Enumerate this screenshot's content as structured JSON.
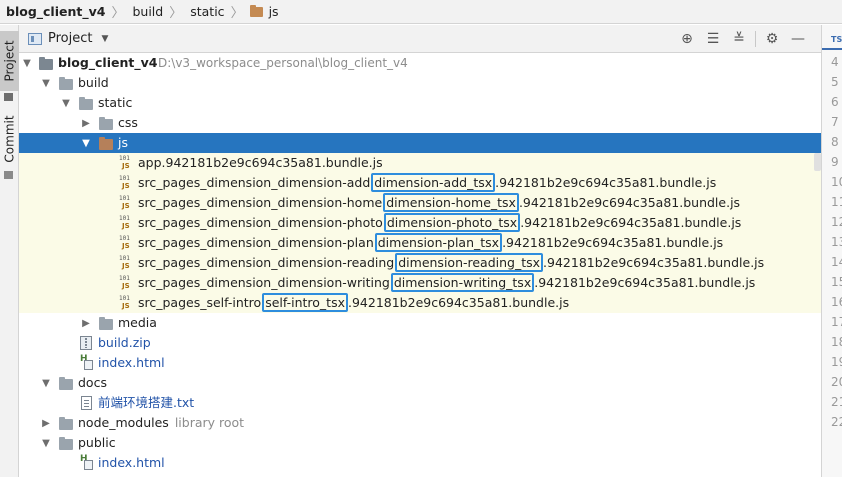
{
  "breadcrumb": {
    "items": [
      "blog_client_v4",
      "build",
      "static",
      "js"
    ]
  },
  "left_strip": {
    "project_tab": "Project",
    "commit_tab": "Commit"
  },
  "panel": {
    "title": "Project",
    "actions": [
      "locate-icon",
      "expand-all-icon",
      "collapse-all-icon",
      "gear-icon",
      "hide-icon"
    ]
  },
  "tree": {
    "root": {
      "label": "blog_client_v4",
      "path": "D:\\v3_workspace_personal\\blog_client_v4"
    },
    "build": "build",
    "static": "static",
    "css": "css",
    "js": "js",
    "js_files": [
      {
        "prefix": "app.942181b2e9c694c35a81.bundle.js",
        "highlight": "",
        "suffix": ""
      },
      {
        "prefix": "src_pages_dimension_dimension-add",
        "highlight": "dimension-add_tsx",
        "suffix": ".942181b2e9c694c35a81.bundle.js"
      },
      {
        "prefix": "src_pages_dimension_dimension-home",
        "highlight": "dimension-home_tsx",
        "suffix": ".942181b2e9c694c35a81.bundle.js"
      },
      {
        "prefix": "src_pages_dimension_dimension-photo",
        "highlight": "dimension-photo_tsx",
        "suffix": ".942181b2e9c694c35a81.bundle.js"
      },
      {
        "prefix": "src_pages_dimension_dimension-plan",
        "highlight": "dimension-plan_tsx",
        "suffix": ".942181b2e9c694c35a81.bundle.js"
      },
      {
        "prefix": "src_pages_dimension_dimension-reading",
        "highlight": "dimension-reading_tsx",
        "suffix": ".942181b2e9c694c35a81.bundle.js"
      },
      {
        "prefix": "src_pages_dimension_dimension-writing",
        "highlight": "dimension-writing_tsx",
        "suffix": ".942181b2e9c694c35a81.bundle.js"
      },
      {
        "prefix": "src_pages_self-intro",
        "highlight": "self-intro_tsx",
        "suffix": ".942181b2e9c694c35a81.bundle.js"
      }
    ],
    "media": "media",
    "build_zip": "build.zip",
    "index_html": "index.html",
    "docs": "docs",
    "doc_file": "前端环境搭建.txt",
    "node_modules": "node_modules",
    "library_root": "library root",
    "public": "public",
    "public_index": "index.html"
  },
  "editor": {
    "tab_label": "TS",
    "line_numbers": [
      "4",
      "5",
      "6",
      "7",
      "8",
      "9",
      "10",
      "11",
      "12",
      "13",
      "14",
      "15",
      "16",
      "17",
      "18",
      "19",
      "20",
      "21",
      "22"
    ]
  },
  "colors": {
    "selection": "#2675bf",
    "highlight_box": "#2e8ddd",
    "changed_row": "#fbfbe7"
  }
}
